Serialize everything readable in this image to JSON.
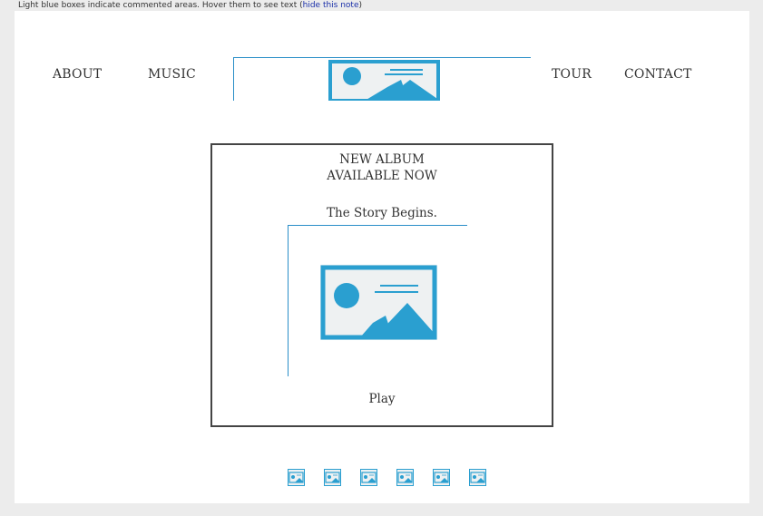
{
  "note": {
    "text": "Light blue boxes indicate commented areas. Hover them to see text (",
    "link": "hide this note",
    "close": ")"
  },
  "nav": {
    "about": "ABOUT",
    "music": "MUSIC",
    "tour": "TOUR",
    "contact": "CONTACT",
    "logo_icon": "image-placeholder-icon"
  },
  "album": {
    "title_line1": "NEW ALBUM",
    "title_line2": "AVAILABLE NOW",
    "subtitle": "The Story Begins.",
    "cover_icon": "image-placeholder-icon",
    "play_label": "Play"
  },
  "thumbnails": {
    "count": 6,
    "icon": "image-placeholder-icon"
  },
  "colors": {
    "accent": "#2a9fd0",
    "comment_border": "#2a8ec8",
    "background": "#ececec",
    "page": "#ffffff"
  }
}
